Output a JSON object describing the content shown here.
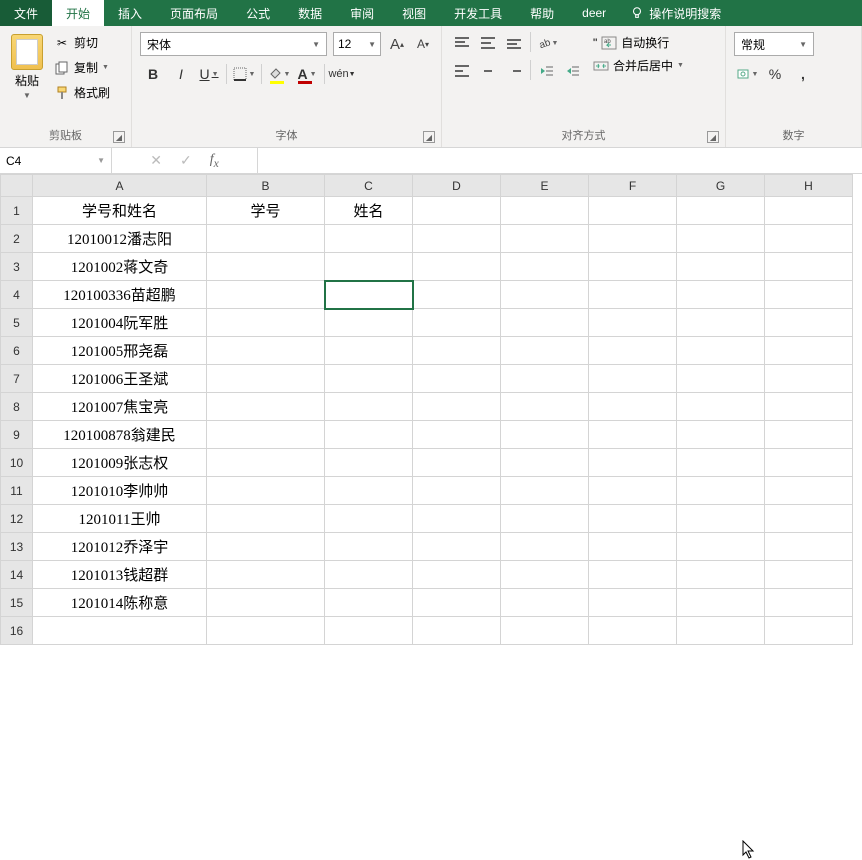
{
  "tabs": {
    "file": "文件",
    "home": "开始",
    "insert": "插入",
    "layout": "页面布局",
    "formulas": "公式",
    "data": "数据",
    "review": "审阅",
    "view": "视图",
    "dev": "开发工具",
    "help": "帮助",
    "deer": "deer",
    "search": "操作说明搜索"
  },
  "clipboard": {
    "paste": "粘贴",
    "cut": "剪切",
    "copy": "复制",
    "format_painter": "格式刷",
    "group_label": "剪贴板"
  },
  "font": {
    "name": "宋体",
    "size": "12",
    "group_label": "字体"
  },
  "alignment": {
    "wrap": "自动换行",
    "merge": "合并后居中",
    "group_label": "对齐方式"
  },
  "number": {
    "format": "常规",
    "group_label": "数字"
  },
  "namebox": "C4",
  "columns": [
    "A",
    "B",
    "C",
    "D",
    "E",
    "F",
    "G",
    "H"
  ],
  "rows": [
    1,
    2,
    3,
    4,
    5,
    6,
    7,
    8,
    9,
    10,
    11,
    12,
    13,
    14,
    15,
    16
  ],
  "selected": {
    "row": 4,
    "col": "C"
  },
  "cells": {
    "A1": "学号和姓名",
    "B1": "学号",
    "C1": "姓名",
    "A2": "12010012潘志阳",
    "A3": "1201002蒋文奇",
    "A4": "120100336苗超鹏",
    "A5": "1201004阮军胜",
    "A6": "1201005邢尧磊",
    "A7": "1201006王圣斌",
    "A8": "1201007焦宝亮",
    "A9": "120100878翁建民",
    "A10": "1201009张志权",
    "A11": "1201010李帅帅",
    "A12": "1201011王帅",
    "A13": "1201012乔泽宇",
    "A14": "1201013钱超群",
    "A15": "1201014陈称意"
  },
  "colors": {
    "brand": "#217346",
    "font_color": "#c00000",
    "fill_color": "#ffff00"
  }
}
